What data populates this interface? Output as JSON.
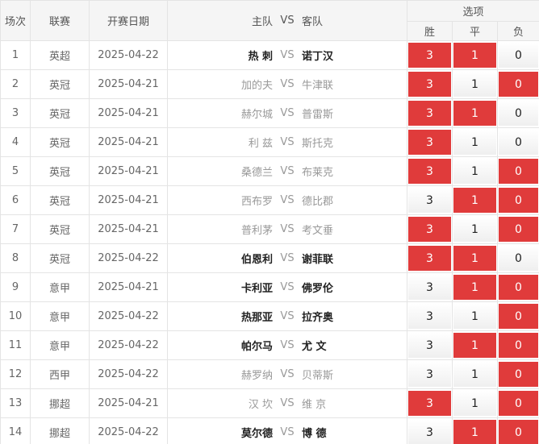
{
  "headers": {
    "round": "场次",
    "league": "联赛",
    "date": "开赛日期",
    "home": "主队",
    "vs": "VS",
    "away": "客队",
    "options": "选项",
    "win": "胜",
    "draw": "平",
    "lose": "负"
  },
  "rows": [
    {
      "num": "1",
      "league": "英超",
      "date": "2025-04-22",
      "home": "热 刺",
      "away": "诺丁汉",
      "bold": true,
      "win": {
        "label": "3",
        "selected": true
      },
      "draw": {
        "label": "1",
        "selected": true
      },
      "lose": {
        "label": "0",
        "selected": false
      }
    },
    {
      "num": "2",
      "league": "英冠",
      "date": "2025-04-21",
      "home": "加的夫",
      "away": "牛津联",
      "bold": false,
      "win": {
        "label": "3",
        "selected": true
      },
      "draw": {
        "label": "1",
        "selected": false
      },
      "lose": {
        "label": "0",
        "selected": true
      }
    },
    {
      "num": "3",
      "league": "英冠",
      "date": "2025-04-21",
      "home": "赫尔城",
      "away": "普雷斯",
      "bold": false,
      "win": {
        "label": "3",
        "selected": true
      },
      "draw": {
        "label": "1",
        "selected": true
      },
      "lose": {
        "label": "0",
        "selected": false
      }
    },
    {
      "num": "4",
      "league": "英冠",
      "date": "2025-04-21",
      "home": "利 兹",
      "away": "斯托克",
      "bold": false,
      "win": {
        "label": "3",
        "selected": true
      },
      "draw": {
        "label": "1",
        "selected": false
      },
      "lose": {
        "label": "0",
        "selected": false
      }
    },
    {
      "num": "5",
      "league": "英冠",
      "date": "2025-04-21",
      "home": "桑德兰",
      "away": "布莱克",
      "bold": false,
      "win": {
        "label": "3",
        "selected": true
      },
      "draw": {
        "label": "1",
        "selected": false
      },
      "lose": {
        "label": "0",
        "selected": true
      }
    },
    {
      "num": "6",
      "league": "英冠",
      "date": "2025-04-21",
      "home": "西布罗",
      "away": "德比郡",
      "bold": false,
      "win": {
        "label": "3",
        "selected": false
      },
      "draw": {
        "label": "1",
        "selected": true
      },
      "lose": {
        "label": "0",
        "selected": true
      }
    },
    {
      "num": "7",
      "league": "英冠",
      "date": "2025-04-21",
      "home": "普利茅",
      "away": "考文垂",
      "bold": false,
      "win": {
        "label": "3",
        "selected": true
      },
      "draw": {
        "label": "1",
        "selected": false
      },
      "lose": {
        "label": "0",
        "selected": true
      }
    },
    {
      "num": "8",
      "league": "英冠",
      "date": "2025-04-22",
      "home": "伯恩利",
      "away": "谢菲联",
      "bold": true,
      "win": {
        "label": "3",
        "selected": true
      },
      "draw": {
        "label": "1",
        "selected": true
      },
      "lose": {
        "label": "0",
        "selected": false
      }
    },
    {
      "num": "9",
      "league": "意甲",
      "date": "2025-04-21",
      "home": "卡利亚",
      "away": "佛罗伦",
      "bold": true,
      "win": {
        "label": "3",
        "selected": false
      },
      "draw": {
        "label": "1",
        "selected": true
      },
      "lose": {
        "label": "0",
        "selected": true
      }
    },
    {
      "num": "10",
      "league": "意甲",
      "date": "2025-04-22",
      "home": "热那亚",
      "away": "拉齐奥",
      "bold": true,
      "win": {
        "label": "3",
        "selected": false
      },
      "draw": {
        "label": "1",
        "selected": false
      },
      "lose": {
        "label": "0",
        "selected": true
      }
    },
    {
      "num": "11",
      "league": "意甲",
      "date": "2025-04-22",
      "home": "帕尔马",
      "away": "尤 文",
      "bold": true,
      "win": {
        "label": "3",
        "selected": false
      },
      "draw": {
        "label": "1",
        "selected": true
      },
      "lose": {
        "label": "0",
        "selected": true
      }
    },
    {
      "num": "12",
      "league": "西甲",
      "date": "2025-04-22",
      "home": "赫罗纳",
      "away": "贝蒂斯",
      "bold": false,
      "win": {
        "label": "3",
        "selected": false
      },
      "draw": {
        "label": "1",
        "selected": false
      },
      "lose": {
        "label": "0",
        "selected": true
      }
    },
    {
      "num": "13",
      "league": "挪超",
      "date": "2025-04-21",
      "home": "汉 坎",
      "away": "维 京",
      "bold": false,
      "win": {
        "label": "3",
        "selected": true
      },
      "draw": {
        "label": "1",
        "selected": false
      },
      "lose": {
        "label": "0",
        "selected": true
      }
    },
    {
      "num": "14",
      "league": "挪超",
      "date": "2025-04-22",
      "home": "莫尔德",
      "away": "博 德",
      "bold": true,
      "win": {
        "label": "3",
        "selected": false
      },
      "draw": {
        "label": "1",
        "selected": true
      },
      "lose": {
        "label": "0",
        "selected": true
      }
    }
  ],
  "colors": {
    "selected_bg": "#e03b3b",
    "header_bg": "#f5f5f5",
    "border": "#e4e4e4"
  }
}
